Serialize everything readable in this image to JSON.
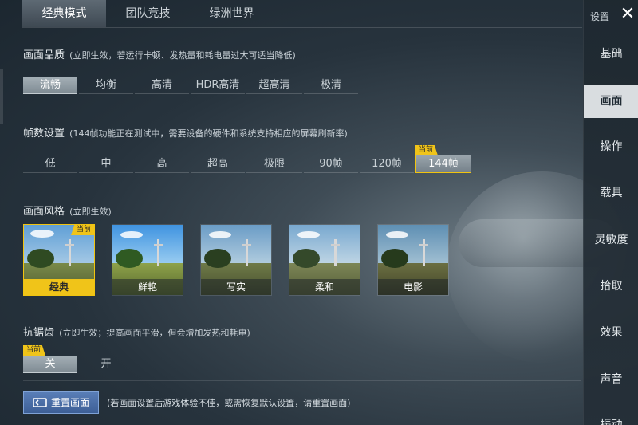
{
  "tabs": [
    {
      "label": "经典模式",
      "active": true
    },
    {
      "label": "团队竞技",
      "active": false
    },
    {
      "label": "绿洲世界",
      "active": false
    }
  ],
  "sidebar": {
    "title": "设置",
    "close_icon": "close-icon",
    "items": [
      {
        "label": "基础"
      },
      {
        "label": "画面",
        "active": true
      },
      {
        "label": "操作"
      },
      {
        "label": "载具"
      },
      {
        "label": "灵敏度"
      },
      {
        "label": "拾取"
      },
      {
        "label": "效果"
      },
      {
        "label": "声音"
      },
      {
        "label": "振动"
      }
    ]
  },
  "quality": {
    "title": "画面品质",
    "note": "(立即生效，若运行卡顿、发热量和耗电量过大可适当降低)",
    "options": [
      "流畅",
      "均衡",
      "高清",
      "HDR高清",
      "超高清",
      "极清"
    ],
    "selected": "流畅"
  },
  "fps": {
    "title": "帧数设置",
    "note": "(144帧功能正在测试中，需要设备的硬件和系统支持相应的屏幕刷新率)",
    "options": [
      "低",
      "中",
      "高",
      "超高",
      "极限",
      "90帧",
      "120帧",
      "144帧"
    ],
    "selected": "144帧",
    "current_tag": "当前"
  },
  "style": {
    "title": "画面风格",
    "note": "(立即生效)",
    "options": [
      "经典",
      "鲜艳",
      "写实",
      "柔和",
      "电影"
    ],
    "selected": "经典",
    "current_tag": "当前"
  },
  "aa": {
    "title": "抗锯齿",
    "note": "(立即生效；提高画面平滑，但会增加发热和耗电)",
    "options": [
      "关",
      "开"
    ],
    "selected": "关",
    "current_tag": "当前"
  },
  "reset": {
    "label": "重置画面",
    "note": "(若画面设置后游戏体验不佳，或需恢复默认设置，请重置画面)"
  },
  "colors": {
    "accent_yellow": "#f0c419",
    "button_blue": "#4a6fa8",
    "selected_gray": "#9aa5ac"
  }
}
